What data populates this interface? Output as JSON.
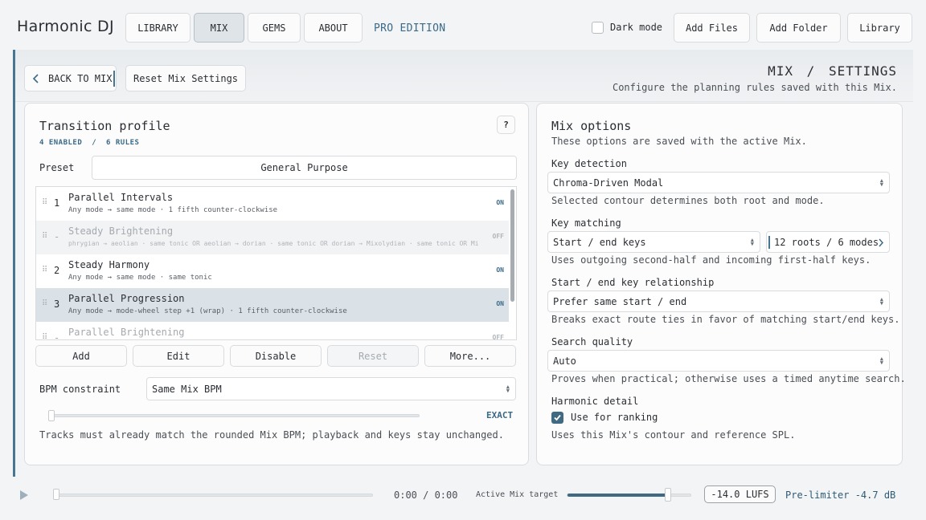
{
  "app": {
    "brand": "Harmonic DJ",
    "edition": "PRO EDITION"
  },
  "nav": {
    "tabs": [
      {
        "label": "LIBRARY"
      },
      {
        "label": "MIX"
      },
      {
        "label": "GEMS"
      },
      {
        "label": "ABOUT"
      }
    ]
  },
  "topbar": {
    "dark_mode_label": "Dark mode",
    "add_files": "Add Files",
    "add_folder": "Add Folder",
    "library": "Library"
  },
  "header": {
    "back_label": "BACK TO MIX",
    "reset_label": "Reset Mix Settings",
    "crumb_section": "MIX",
    "crumb_sep": "/",
    "crumb_page": "SETTINGS",
    "subtitle": "Configure the planning rules saved with this Mix."
  },
  "transition": {
    "title": "Transition profile",
    "help": "?",
    "enabled_count": "4 ENABLED",
    "sep": "/",
    "rules_count": "6 RULES",
    "preset_label": "Preset",
    "preset_value": "General Purpose",
    "rules": [
      {
        "num": "1",
        "name": "Parallel Intervals",
        "sub": "Any mode → same mode · 1 fifth counter-clockwise",
        "state": "ON"
      },
      {
        "num": "-",
        "name": "Steady Brightening",
        "sub": "phrygian → aeolian · same tonic OR aeolian → dorian · same tonic OR dorian → Mixolydian · same tonic OR Mixolydian → Ionian · same tonic OR…",
        "state": "OFF"
      },
      {
        "num": "2",
        "name": "Steady Harmony",
        "sub": "Any mode → same mode · same tonic",
        "state": "ON"
      },
      {
        "num": "3",
        "name": "Parallel Progression",
        "sub": "Any mode → mode-wheel step +1 (wrap) · 1 fifth counter-clockwise",
        "state": "ON"
      },
      {
        "num": "-",
        "name": "Parallel Brightening",
        "sub": "",
        "state": "OFF"
      }
    ],
    "actions": {
      "add": "Add",
      "edit": "Edit",
      "disable": "Disable",
      "reset": "Reset",
      "more": "More..."
    },
    "bpm_label": "BPM constraint",
    "bpm_value": "Same Mix BPM",
    "bpm_tolerance": "EXACT",
    "bpm_desc": "Tracks must already match the rounded Mix BPM; playback and keys stay unchanged."
  },
  "options": {
    "title": "Mix options",
    "subtitle": "These options are saved with the active Mix.",
    "key_detection_label": "Key detection",
    "key_detection_value": "Chroma-Driven Modal",
    "key_detection_desc": "Selected contour determines both root and mode.",
    "key_matching_label": "Key matching",
    "key_matching_value": "Start / end keys",
    "key_matching_roots": "12 roots / 6 modes",
    "key_matching_desc": "Uses outgoing second-half and incoming first-half keys.",
    "relationship_label": "Start / end key relationship",
    "relationship_value": "Prefer same start / end",
    "relationship_desc": "Breaks exact route ties in favor of matching start/end keys.",
    "search_label": "Search quality",
    "search_value": "Auto",
    "search_desc": "Proves when practical; otherwise uses a timed anytime search.",
    "harmonic_label": "Harmonic detail",
    "harmonic_check": "Use for ranking",
    "harmonic_desc": "Uses this Mix's contour and reference SPL."
  },
  "player": {
    "time": "0:00 / 0:00",
    "target_label": "Active Mix target",
    "target_level": 0.81,
    "lufs": "-14.0 LUFS",
    "prelimiter": "Pre-limiter -4.7 dB"
  },
  "colors": {
    "accent": "#3a6a88",
    "rule": "#48758f",
    "selected_row": "#dbe2e7"
  }
}
